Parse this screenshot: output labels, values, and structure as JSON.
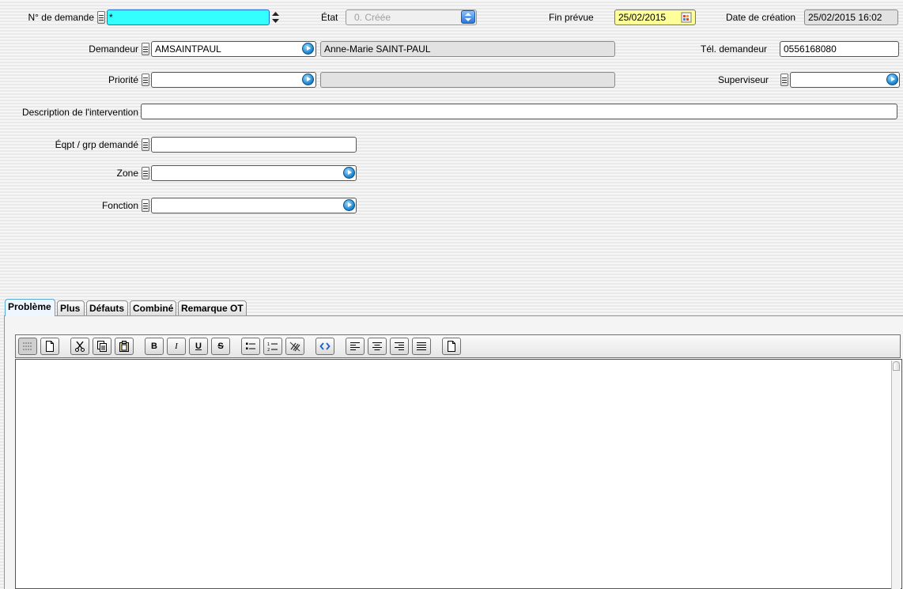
{
  "form": {
    "demande": {
      "label": "N° de demande",
      "value": "*"
    },
    "etat": {
      "label": "État",
      "value": "0. Créée"
    },
    "fin_prevue": {
      "label": "Fin prévue",
      "value": "25/02/2015"
    },
    "date_creation": {
      "label": "Date de création",
      "value": "25/02/2015 16:02"
    },
    "demandeur": {
      "label": "Demandeur",
      "code": "AMSAINTPAUL",
      "name": "Anne-Marie SAINT-PAUL"
    },
    "tel_demandeur": {
      "label": "Tél. demandeur",
      "value": "0556168080"
    },
    "priorite": {
      "label": "Priorité",
      "code": "",
      "name": ""
    },
    "superviseur": {
      "label": "Superviseur",
      "value": ""
    },
    "description": {
      "label": "Description de l'intervention",
      "value": ""
    },
    "eqpt": {
      "label": "Éqpt / grp demandé",
      "value": ""
    },
    "zone": {
      "label": "Zone",
      "value": ""
    },
    "fonction": {
      "label": "Fonction",
      "value": ""
    }
  },
  "tabs": [
    {
      "label": "Problème",
      "active": true
    },
    {
      "label": "Plus",
      "active": false
    },
    {
      "label": "Défauts",
      "active": false
    },
    {
      "label": "Combiné",
      "active": false
    },
    {
      "label": "Remarque OT",
      "active": false
    }
  ],
  "toolbar": {
    "bold": "B",
    "italic": "I",
    "underline": "U",
    "strike": "S"
  },
  "editor": {
    "content": ""
  },
  "colors": {
    "focus": "#33ffff",
    "date_bg": "#ffff99",
    "tab_active_border": "#58a7d8"
  }
}
